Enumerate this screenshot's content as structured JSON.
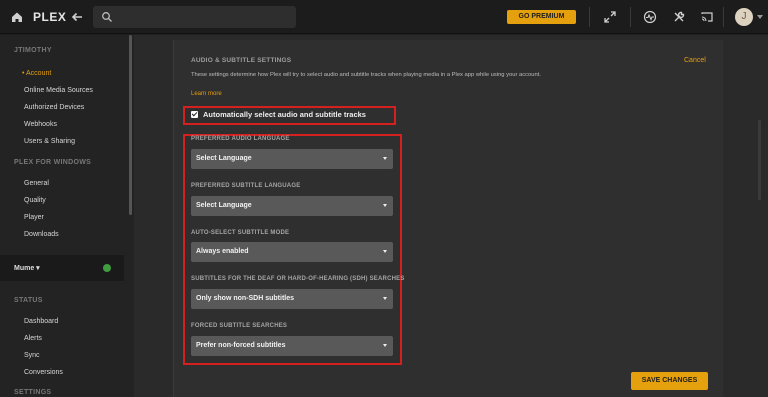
{
  "topbar": {
    "logo": "PLEX",
    "premium_label": "GO PREMIUM",
    "avatar_initial": "J",
    "icons": [
      "home-icon",
      "back-arrow-icon",
      "search-icon",
      "fullscreen-icon",
      "activity-icon",
      "settings-tools-icon",
      "cast-icon"
    ]
  },
  "sidebar": {
    "user_heading": "JTIMOTHY",
    "account_items": [
      {
        "label": "Account"
      },
      {
        "label": "Online Media Sources"
      },
      {
        "label": "Authorized Devices"
      },
      {
        "label": "Webhooks"
      },
      {
        "label": "Users & Sharing"
      }
    ],
    "windows_heading": "PLEX FOR WINDOWS",
    "windows_items": [
      {
        "label": "General"
      },
      {
        "label": "Quality"
      },
      {
        "label": "Player"
      },
      {
        "label": "Downloads"
      }
    ],
    "server_name": "Mume",
    "status_heading": "STATUS",
    "status_items": [
      {
        "label": "Dashboard"
      },
      {
        "label": "Alerts"
      },
      {
        "label": "Sync"
      },
      {
        "label": "Conversions"
      }
    ],
    "settings_heading": "SETTINGS"
  },
  "panel": {
    "title": "AUDIO & SUBTITLE SETTINGS",
    "cancel_label": "Cancel",
    "description": "These settings determine how Plex will try to select audio and subtitle tracks when playing media in a Plex app while using your account.",
    "learn_more": "Learn more",
    "auto_select_label": "Automatically select audio and subtitle tracks",
    "auto_select_checked": true,
    "fields": [
      {
        "label": "PREFERRED AUDIO LANGUAGE",
        "value": "Select Language"
      },
      {
        "label": "PREFERRED SUBTITLE LANGUAGE",
        "value": "Select Language"
      },
      {
        "label": "AUTO-SELECT SUBTITLE MODE",
        "value": "Always enabled"
      },
      {
        "label": "SUBTITLES FOR THE DEAF OR HARD-OF-HEARING (SDH) SEARCHES",
        "value": "Only show non-SDH subtitles"
      },
      {
        "label": "FORCED SUBTITLE SEARCHES",
        "value": "Prefer non-forced subtitles"
      }
    ],
    "save_label": "SAVE CHANGES"
  },
  "colors": {
    "accent": "#e5a00d",
    "highlight_outline": "#d52020",
    "server_online": "#3f9d3f"
  }
}
